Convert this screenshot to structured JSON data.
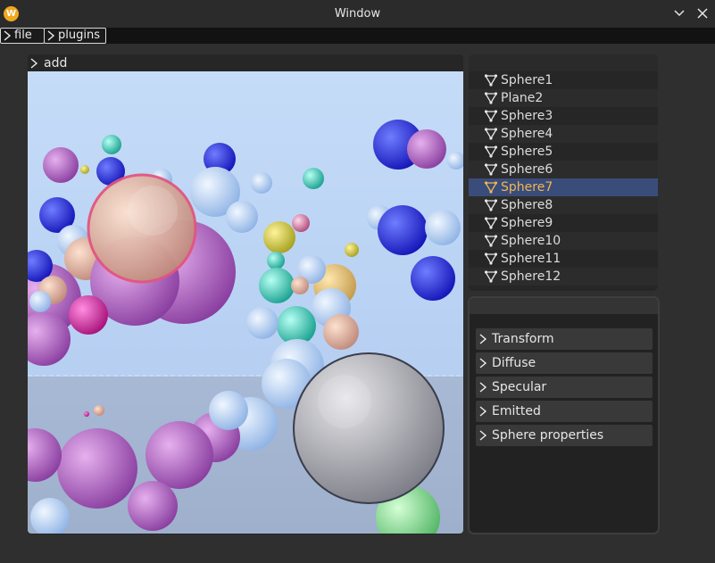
{
  "window": {
    "title": "Window",
    "icon": "app-logo-icon",
    "minimize_icon": "chevron-down-icon",
    "close_icon": "close-icon"
  },
  "menubar": {
    "items": [
      {
        "label": "file"
      },
      {
        "label": "plugins"
      }
    ]
  },
  "viewport": {
    "add_label": "add"
  },
  "scene_list": {
    "items": [
      {
        "label": "Sphere1"
      },
      {
        "label": "Plane2"
      },
      {
        "label": "Sphere3"
      },
      {
        "label": "Sphere4"
      },
      {
        "label": "Sphere5"
      },
      {
        "label": "Sphere6"
      },
      {
        "label": "Sphere7"
      },
      {
        "label": "Sphere8"
      },
      {
        "label": "Sphere9"
      },
      {
        "label": "Sphere10"
      },
      {
        "label": "Sphere11"
      },
      {
        "label": "Sphere12"
      }
    ],
    "selected": "Sphere7"
  },
  "properties": {
    "sections": [
      {
        "label": "Transform"
      },
      {
        "label": "Diffuse"
      },
      {
        "label": "Specular"
      },
      {
        "label": "Emitted"
      },
      {
        "label": "Sphere properties"
      }
    ]
  },
  "colors": {
    "accent_selected_bg": "#3a4c7a",
    "accent_selected_text": "#f3b64e",
    "sky": "#bdd7f7",
    "floor": "#a9bbd6"
  }
}
